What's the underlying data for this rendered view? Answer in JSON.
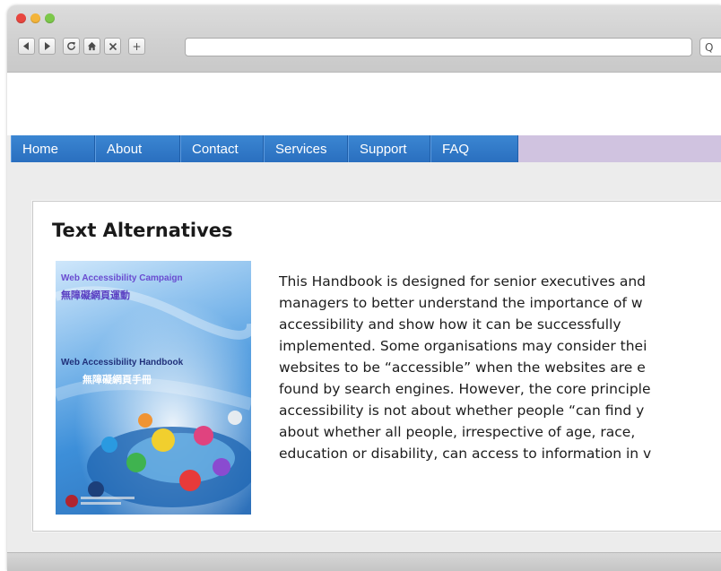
{
  "browser": {
    "window_controls": {
      "close_color": "#e8463f",
      "minimize_color": "#f3b43a",
      "maximize_color": "#7cc84a"
    },
    "toolbar": {
      "back_icon": "back-arrow-icon",
      "forward_icon": "forward-arrow-icon",
      "reload_icon": "reload-icon",
      "home_icon": "home-icon",
      "stop_icon": "close-icon",
      "new_tab_label": "+"
    },
    "url": "",
    "search_icon_glyph": "Q"
  },
  "nav": {
    "accent_color": "#2f78c6",
    "items": [
      {
        "label": "Home"
      },
      {
        "label": "About"
      },
      {
        "label": "Contact"
      },
      {
        "label": "Services"
      },
      {
        "label": "Support"
      },
      {
        "label": "FAQ"
      }
    ]
  },
  "main": {
    "heading": "Text Alternatives",
    "cover": {
      "campaign_title": "Web Accessibility Campaign",
      "campaign_title_cn": "無障礙網頁運動",
      "handbook_title": "Web Accessibility Handbook",
      "handbook_title_cn": "無障礙網頁手冊"
    },
    "paragraph_lines": [
      "This Handbook is designed for senior executives and",
      "managers to better understand the importance of w",
      "accessibility and show how it can be successfully",
      "implemented. Some organisations may consider thei",
      "websites to be “accessible” when the websites are e",
      "found by search engines. However, the core principle",
      "accessibility is not about whether people “can find y",
      "about whether all people, irrespective of age, race,",
      "education or disability, can access to information in v"
    ]
  }
}
